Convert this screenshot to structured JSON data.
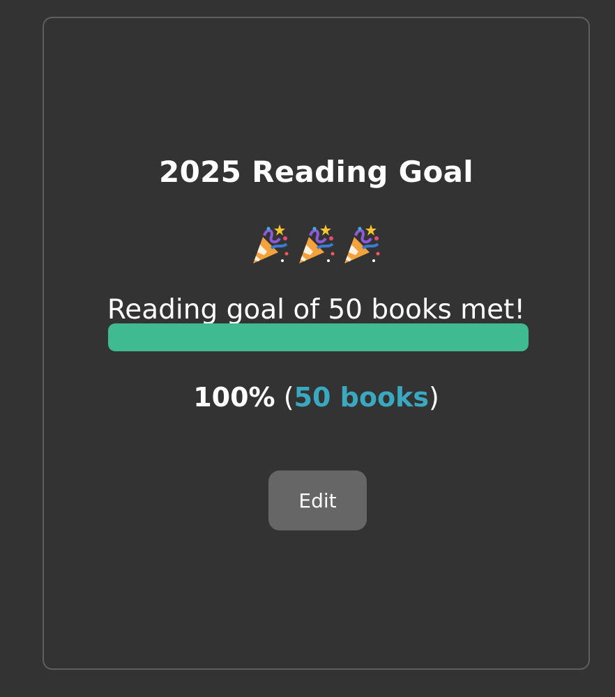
{
  "goal_card": {
    "title": "2025 Reading Goal",
    "celebration_icons": [
      "party-popper-icon",
      "party-popper-icon",
      "party-popper-icon"
    ],
    "message": "Reading goal of 50 books met!",
    "progress_fraction": 1.0,
    "percent_text": "100%",
    "paren_open": " (",
    "books_text": "50 books",
    "paren_close": ")",
    "edit_label": "Edit"
  },
  "colors": {
    "background": "#333333",
    "card_border": "#5f5f5f",
    "progress_fill": "#40bb91",
    "books_highlight": "#3aa9c0",
    "edit_button": "#666666"
  }
}
